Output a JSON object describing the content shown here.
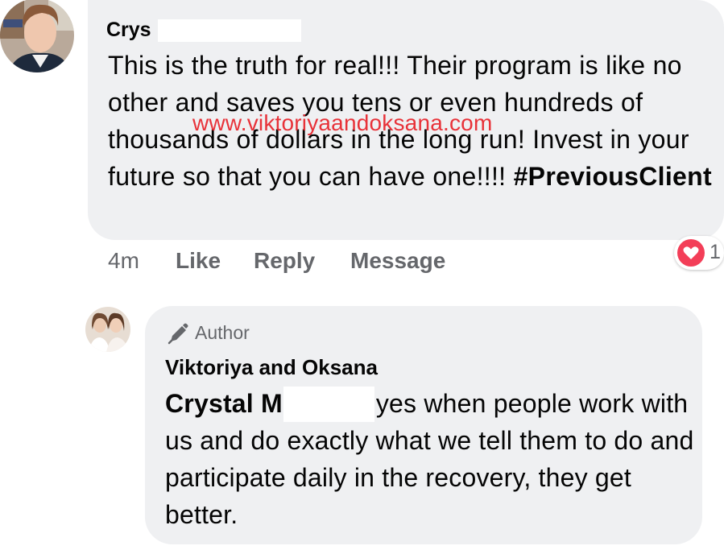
{
  "comment": {
    "author": "Crys",
    "text": "This is the truth for real!!! Their program is like no other and saves you tens or even hundreds of thousands of dollars in the long run! Invest in your future so that you can have one!!!! ",
    "hashtag": "#PreviousClient",
    "watermark": "www.viktoriyaandoksana.com",
    "time": "4m",
    "like_label": "Like",
    "reply_label": "Reply",
    "message_label": "Message",
    "reaction": {
      "icon": "heart-icon",
      "count": "1",
      "color": "#f33e58"
    }
  },
  "reply": {
    "badge": "Author",
    "badge_icon": "pencil-icon",
    "author": "Viktoriya and Oksana",
    "mention": "Crystal M",
    "text": "yes when people work with us and do exactly what we tell them to do and participate daily in the recovery, they get better."
  },
  "colors": {
    "bubble": "#eff0f2",
    "secondary_text": "#65676b",
    "watermark": "#e8222a"
  }
}
